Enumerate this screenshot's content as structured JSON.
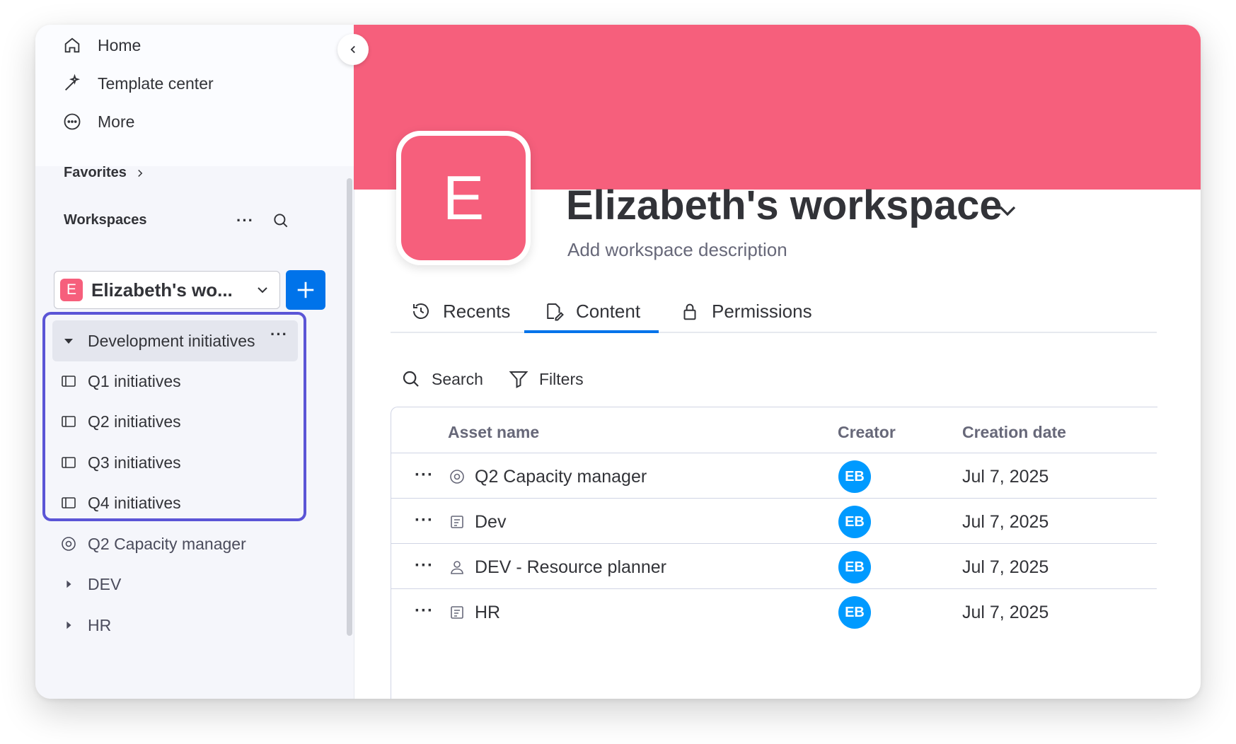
{
  "nav": {
    "home": "Home",
    "templates": "Template center",
    "more": "More"
  },
  "favorites_label": "Favorites",
  "workspaces_label": "Workspaces",
  "workspace_select": {
    "badge": "E",
    "name": "Elizabeth's wo..."
  },
  "tree": {
    "folder": "Development initiatives",
    "items": [
      "Q1 initiatives",
      "Q2 initiatives",
      "Q3 initiatives",
      "Q4 initiatives"
    ],
    "capacity": "Q2 Capacity manager",
    "dev": "DEV",
    "hr": "HR"
  },
  "workspace": {
    "badge": "E",
    "title": "Elizabeth's workspace",
    "description": "Add workspace description"
  },
  "tabs": [
    {
      "label": "Recents"
    },
    {
      "label": "Content",
      "active": true
    },
    {
      "label": "Permissions"
    }
  ],
  "toolbar": {
    "search": "Search",
    "filters": "Filters"
  },
  "table": {
    "headers": {
      "name": "Asset name",
      "creator": "Creator",
      "date": "Creation date"
    },
    "rows": [
      {
        "name": "Q2 Capacity manager",
        "icon": "dashboard-icon",
        "creator": "EB",
        "date": "Jul 7, 2025"
      },
      {
        "name": "Dev",
        "icon": "doc-icon",
        "creator": "EB",
        "date": "Jul 7, 2025"
      },
      {
        "name": "DEV - Resource planner",
        "icon": "person-icon",
        "creator": "EB",
        "date": "Jul 7, 2025"
      },
      {
        "name": "HR",
        "icon": "doc-icon",
        "creator": "EB",
        "date": "Jul 7, 2025"
      }
    ]
  },
  "colors": {
    "brand_pink": "#f65f7c",
    "primary_blue": "#0073ea",
    "highlight": "#5b55d6",
    "avatar": "#009aff"
  }
}
